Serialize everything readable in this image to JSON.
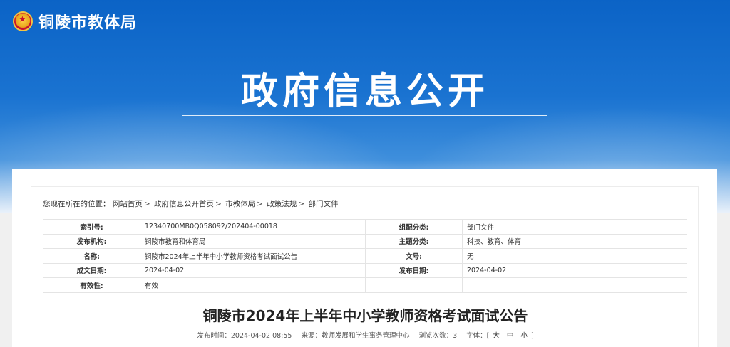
{
  "header": {
    "site_name": "铜陵市教体局",
    "hero_title": "政府信息公开"
  },
  "breadcrumb": {
    "label": "您现在所在的位置：",
    "items": [
      "网站首页",
      "政府信息公开首页",
      "市教体局",
      "政策法规",
      "部门文件"
    ],
    "separator": ">"
  },
  "meta": {
    "rows": [
      {
        "k1": "索引号:",
        "v1": "12340700MB0Q058092/202404-00018",
        "k2": "组配分类:",
        "v2": "部门文件"
      },
      {
        "k1": "发布机构:",
        "v1": "铜陵市教育和体育局",
        "k2": "主题分类:",
        "v2": "科技、教育、体育"
      },
      {
        "k1": "名称:",
        "v1": "铜陵市2024年上半年中小学教师资格考试面试公告",
        "k2": "文号:",
        "v2": "无"
      },
      {
        "k1": "成文日期:",
        "v1": "2024-04-02",
        "k2": "发布日期:",
        "v2": "2024-04-02"
      },
      {
        "k1": "有效性:",
        "v1": "有效",
        "k2": "",
        "v2": ""
      }
    ]
  },
  "document": {
    "title": "铜陵市2024年上半年中小学教师资格考试面试公告",
    "publish_time_label": "发布时间：",
    "publish_time": "2024-04-02 08:55",
    "source_label": "来源：",
    "source": "教师发展和学生事务管理中心",
    "views_label": "浏览次数：",
    "views": "3",
    "font_label": "字体：",
    "font_open": "[",
    "font_large": "大",
    "font_medium": "中",
    "font_small": "小",
    "font_close": "]"
  },
  "colors": {
    "banner_blue": "#0b63c6",
    "emblem_red": "#c8102e"
  }
}
